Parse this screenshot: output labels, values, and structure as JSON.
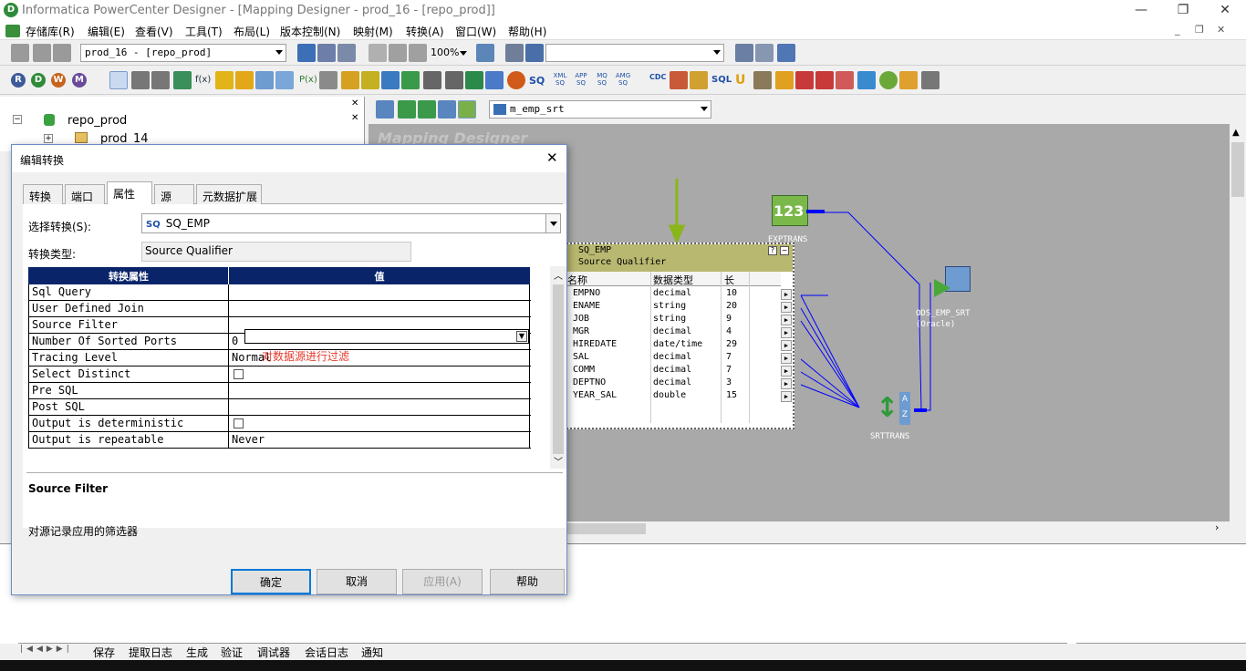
{
  "window": {
    "title": "Informatica PowerCenter Designer - [Mapping Designer - prod_16 - [repo_prod]]",
    "min_icon": "minimize-icon",
    "restore_icon": "restore-icon",
    "close_icon": "close-icon",
    "close_glyph": "✕"
  },
  "menubar": {
    "items": [
      "存储库(R)",
      "编辑(E)",
      "查看(V)",
      "工具(T)",
      "布局(L)",
      "版本控制(N)",
      "映射(M)",
      "转换(A)",
      "窗口(W)",
      "帮助(H)"
    ]
  },
  "toolbar1": {
    "folder_combo": "prod_16 - [repo_prod]",
    "zoom": "100%"
  },
  "toolbar2": {
    "letters": [
      "R",
      "D",
      "W",
      "M"
    ],
    "tool_labels": [
      "f(x)",
      "P(x)",
      "SQ",
      "XML SQ",
      "APP SQ",
      "MQ SQ",
      "AMG SQ",
      "CDC",
      "SQL",
      "U"
    ]
  },
  "navigator": {
    "repo": "repo_prod",
    "folder": "prod_14"
  },
  "canvas": {
    "watermark": "Mapping Designer",
    "mapping_combo": "m_emp_srt",
    "sq": {
      "name": "SQ_EMP",
      "type": "Source Qualifier",
      "columns": [
        "名称",
        "数据类型",
        "长"
      ],
      "ports": [
        {
          "name": "EMPNO",
          "type": "decimal",
          "len": "10"
        },
        {
          "name": "ENAME",
          "type": "string",
          "len": "20"
        },
        {
          "name": "JOB",
          "type": "string",
          "len": "9"
        },
        {
          "name": "MGR",
          "type": "decimal",
          "len": "4"
        },
        {
          "name": "HIREDATE",
          "type": "date/time",
          "len": "29"
        },
        {
          "name": "SAL",
          "type": "decimal",
          "len": "7"
        },
        {
          "name": "COMM",
          "type": "decimal",
          "len": "7"
        },
        {
          "name": "DEPTNO",
          "type": "decimal",
          "len": "3"
        },
        {
          "name": "YEAR_SAL",
          "type": "double",
          "len": "15"
        }
      ]
    },
    "exptrans_label": "EXPTRANS",
    "target_label": "ODS_EMP_SRT (Oracle)",
    "srttrans_label": "SRTTRANS"
  },
  "dialog": {
    "title": "编辑转换",
    "tabs": [
      "转换",
      "端口",
      "属性",
      "源",
      "元数据扩展"
    ],
    "active_tab": "属性",
    "select_label": "选择转换(S):",
    "select_value": "SQ_EMP",
    "select_badge": "SQ",
    "type_label": "转换类型:",
    "type_value": "Source Qualifier",
    "header_prop": "转换属性",
    "header_val": "值",
    "properties": [
      {
        "name": "Sql Query",
        "value": "",
        "kind": "text"
      },
      {
        "name": "User Defined Join",
        "value": "",
        "kind": "text"
      },
      {
        "name": "Source Filter",
        "value": "",
        "kind": "dropdown"
      },
      {
        "name": "Number Of Sorted Ports",
        "value": "0",
        "kind": "text"
      },
      {
        "name": "Tracing Level",
        "value": "Normal",
        "kind": "text"
      },
      {
        "name": "Select Distinct",
        "value": "",
        "kind": "checkbox"
      },
      {
        "name": "Pre SQL",
        "value": "",
        "kind": "text"
      },
      {
        "name": "Post SQL",
        "value": "",
        "kind": "text"
      },
      {
        "name": "Output is deterministic",
        "value": "",
        "kind": "checkbox"
      },
      {
        "name": "Output is repeatable",
        "value": "Never",
        "kind": "text"
      }
    ],
    "annotation": "对数据源进行过滤",
    "desc_title": "Source Filter",
    "desc_text": "对源记录应用的筛选器",
    "buttons": {
      "ok": "确定",
      "cancel": "取消",
      "apply": "应用(A)",
      "help": "帮助"
    }
  },
  "bottom_tabs": [
    "保存",
    "提取日志",
    "生成",
    "验证",
    "调试器",
    "会话日志",
    "通知"
  ],
  "colors": {
    "accent": "#0a246a",
    "annotation": "#e8392c",
    "link": "#0000ff",
    "sq_header": "#b8b870",
    "canvas": "#a9a9a9"
  }
}
